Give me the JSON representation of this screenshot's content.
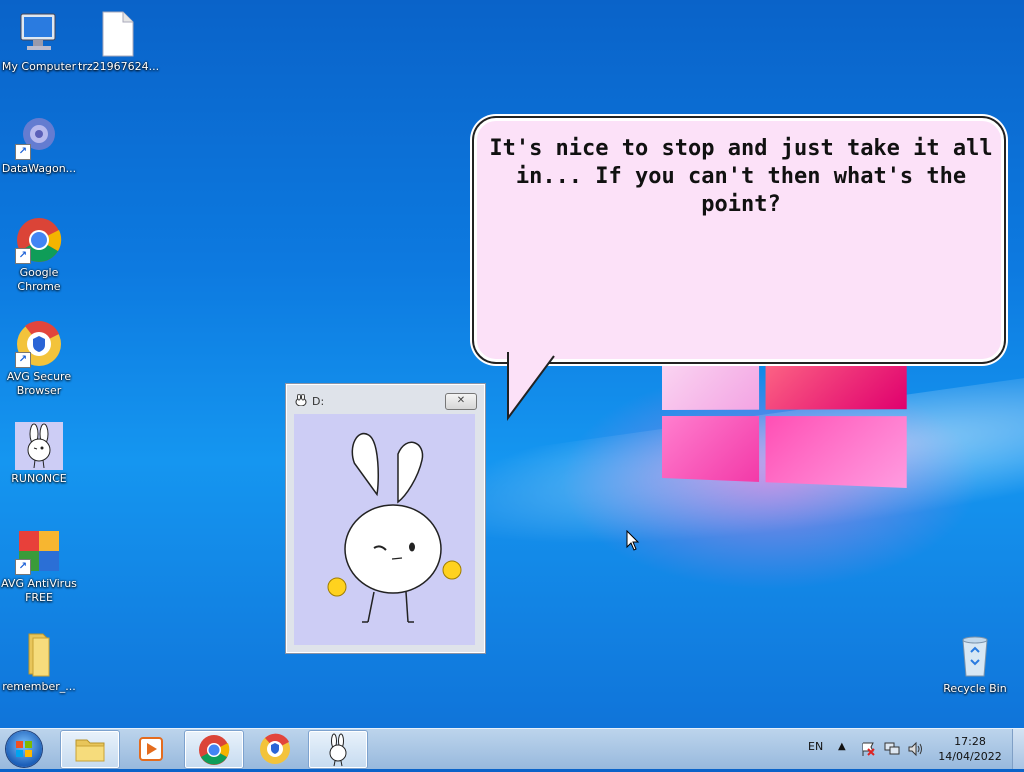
{
  "desktop": {
    "icons": [
      {
        "label": "My Computer"
      },
      {
        "label": "trz21967624..."
      },
      {
        "label": "DataWagon..."
      },
      {
        "label": "Google Chrome"
      },
      {
        "label": "AVG Secure Browser"
      },
      {
        "label": "RUNONCE"
      },
      {
        "label": "AVG AntiVirus FREE"
      },
      {
        "label": "remember_..."
      },
      {
        "label": "Recycle Bin"
      }
    ]
  },
  "bubble": {
    "text": "It's nice to stop and just take it all in... If you can't then what's the point?"
  },
  "window": {
    "title": "D:",
    "close_glyph": "✕"
  },
  "taskbar": {
    "language": "EN",
    "time": "17:28",
    "date": "14/04/2022"
  },
  "colors": {
    "bubble_bg": "#fce1f8",
    "window_body": "#cdcdf5"
  }
}
